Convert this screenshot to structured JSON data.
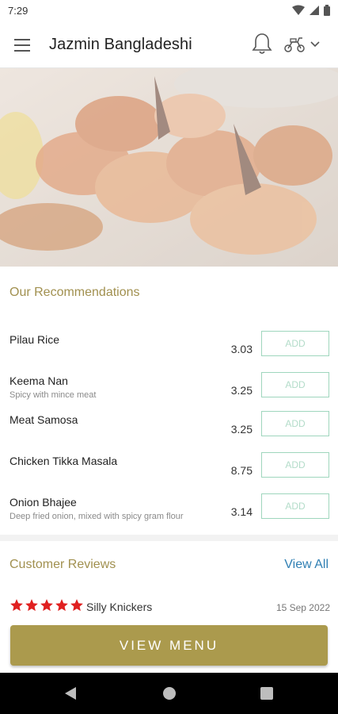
{
  "status_bar": {
    "time": "7:29",
    "icons": [
      "wifi-icon",
      "signal-icon",
      "battery-icon"
    ]
  },
  "app_bar": {
    "title": "Jazmin Bangladeshi",
    "icons": [
      "hamburger-menu-icon",
      "bell-icon",
      "scooter-icon",
      "chevron-down-icon"
    ]
  },
  "hero": {
    "alt": "Tandoori king prawns"
  },
  "recommendations": {
    "title": "Our Recommendations",
    "add_label": "ADD",
    "items": [
      {
        "name": "Pilau Rice",
        "description": "",
        "price": "3.03"
      },
      {
        "name": "Keema Nan",
        "description": "Spicy with mince meat",
        "price": "3.25"
      },
      {
        "name": "Meat Samosa",
        "description": "",
        "price": "3.25"
      },
      {
        "name": "Chicken Tikka Masala",
        "description": "",
        "price": "8.75"
      },
      {
        "name": "Onion Bhajee",
        "description": "Deep fried onion, mixed with spicy gram flour",
        "price": "3.14"
      }
    ]
  },
  "reviews": {
    "title": "Customer Reviews",
    "view_all": "View All",
    "latest": {
      "rating": 5,
      "reviewer": "Silly Knickers",
      "date": "15 Sep 2022"
    }
  },
  "cta": {
    "label": "VIEW MENU"
  },
  "colors": {
    "brand_gold": "#ab9a4d",
    "section_title": "#a1904f",
    "link_blue": "#2f7fb3",
    "add_border": "#9fd6bd",
    "star_red": "#e02020"
  },
  "nav_bar": {
    "icons": [
      "back-icon",
      "home-icon",
      "recents-icon"
    ]
  }
}
